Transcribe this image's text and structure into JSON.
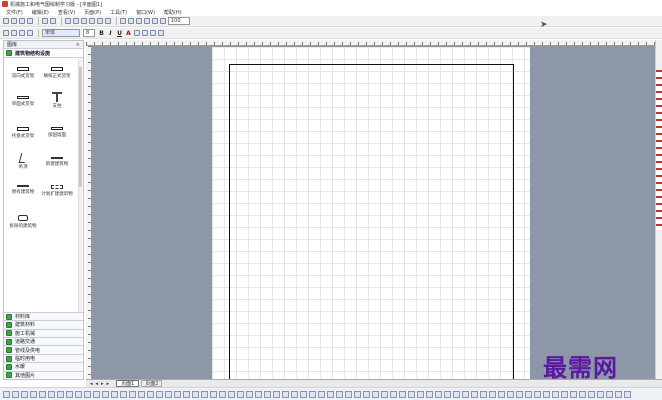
{
  "window": {
    "title": "机械施工和电气图绘制学习版 - [平面图1]"
  },
  "menu": [
    "文件(F)",
    "编辑(E)",
    "查看(V)",
    "页面(P)",
    "工具(T)",
    "窗口(W)",
    "帮助(H)"
  ],
  "toolbar": {
    "zoom": "100",
    "font": "宋体",
    "size": "8"
  },
  "shapes_panel": {
    "header": "图库",
    "close": "×",
    "stencil_title": "建筑物结构设施",
    "shapes": [
      {
        "label": "双向式货架"
      },
      {
        "label": "横排正式货架"
      },
      {
        "label": "单面式货架"
      },
      {
        "label": "支柱"
      },
      {
        "label": "托盘式货架"
      },
      {
        "label": "加固墙面"
      },
      {
        "label": "吊顶"
      },
      {
        "label": "新建建筑物"
      },
      {
        "label": "原有建筑物"
      },
      {
        "label": "计划扩建建筑物"
      },
      {
        "label": "拆除的建筑物"
      }
    ],
    "stencils": [
      "材料库",
      " 建筑材料",
      "施工机械",
      "道路交通",
      "管线及供电",
      "临时用电",
      "水暖",
      "其他图片"
    ]
  },
  "document": {
    "tabs": [
      "页面1",
      "页面2"
    ]
  },
  "watermark": "最需网"
}
